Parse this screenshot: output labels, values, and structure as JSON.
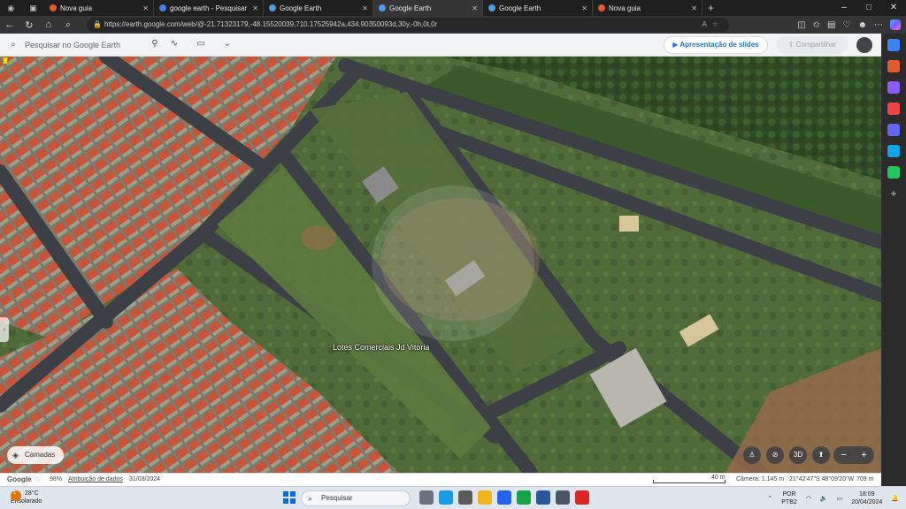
{
  "browser": {
    "tabs": [
      {
        "title": "Nova guia",
        "active": false,
        "favicon_color": "#e05a2b"
      },
      {
        "title": "google earth - Pesquisar",
        "active": false,
        "favicon_color": "#3b82f6"
      },
      {
        "title": "Google Earth",
        "active": false,
        "favicon_color": "#4c9be8"
      },
      {
        "title": "Google Earth",
        "active": true,
        "favicon_color": "#4c9be8"
      },
      {
        "title": "Google Earth",
        "active": false,
        "favicon_color": "#4c9be8"
      },
      {
        "title": "Nova guia",
        "active": false,
        "favicon_color": "#e05a2b"
      }
    ],
    "url": "https://earth.google.com/web/@-21.71323179,-48.15520039,710.17525942a,434.90350093d,30y,-0h,0t,0r",
    "new_tab_label": "+",
    "window_controls": [
      "–",
      "□",
      "✕"
    ]
  },
  "earth": {
    "search_placeholder": "Pesquisar no Google Earth",
    "slides_button": "Apresentação de slides",
    "share_button": "Compartilhar",
    "place_label": "Lotes Comerciais Jd Vitoria",
    "layers_button": "Camadas",
    "control_3d": "3D",
    "zoom_out": "−",
    "zoom_in": "+"
  },
  "statusbar": {
    "logo": "Google",
    "zoom_percent": "98%",
    "attribution": "Atribuição de dados",
    "imagery_date": "31/03/2024",
    "scale_label": "40 m",
    "camera": "Câmera: 1.145 m",
    "coordinates": "21°42'47\"S 48°09'20\"W",
    "elevation": "709 m"
  },
  "taskbar": {
    "weather_temp": "28°C",
    "weather_desc": "Ensolarado",
    "weather_badge": "1",
    "search_label": "Pesquisar",
    "language": "POR",
    "layout": "PTB2",
    "time": "18:09",
    "date": "20/04/2024"
  }
}
